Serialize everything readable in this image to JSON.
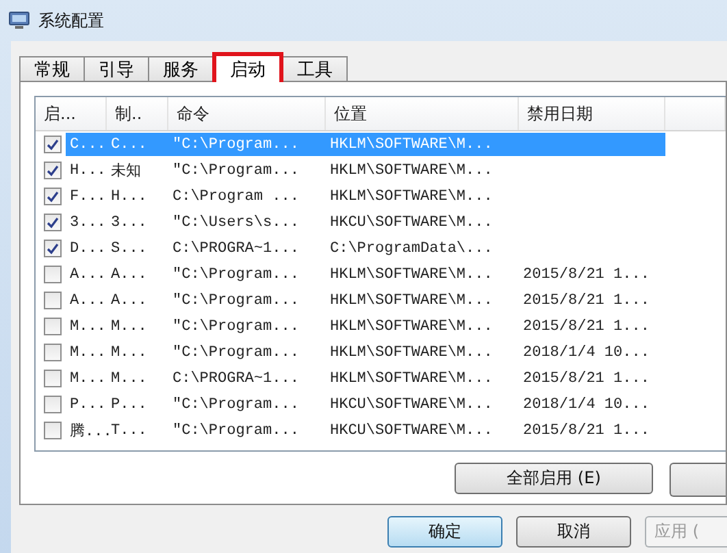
{
  "window": {
    "title": "系统配置"
  },
  "tabs": [
    {
      "label": "常规",
      "selected": false,
      "highlighted": false
    },
    {
      "label": "引导",
      "selected": false,
      "highlighted": false
    },
    {
      "label": "服务",
      "selected": false,
      "highlighted": false
    },
    {
      "label": "启动",
      "selected": true,
      "highlighted": true
    },
    {
      "label": "工具",
      "selected": false,
      "highlighted": false
    }
  ],
  "table": {
    "columns": [
      "启...",
      "制..",
      "命令",
      "位置",
      "禁用日期"
    ],
    "rows": [
      {
        "checked": true,
        "selected": true,
        "cells": [
          "C...",
          "C...",
          "\"C:\\Program...",
          "HKLM\\SOFTWARE\\M..."
        ]
      },
      {
        "checked": true,
        "selected": false,
        "cells": [
          "H...",
          "未知",
          "\"C:\\Program...",
          "HKLM\\SOFTWARE\\M..."
        ]
      },
      {
        "checked": true,
        "selected": false,
        "cells": [
          "F...",
          "H...",
          "C:\\Program ...",
          "HKLM\\SOFTWARE\\M..."
        ]
      },
      {
        "checked": true,
        "selected": false,
        "cells": [
          "3...",
          "3...",
          "\"C:\\Users\\s...",
          "HKCU\\SOFTWARE\\M..."
        ]
      },
      {
        "checked": true,
        "selected": false,
        "cells": [
          "D...",
          "S...",
          "C:\\PROGRA~1...",
          "C:\\ProgramData\\..."
        ]
      },
      {
        "checked": false,
        "selected": false,
        "cells": [
          "A...",
          "A...",
          "\"C:\\Program...",
          "HKLM\\SOFTWARE\\M...",
          "2015/8/21 1..."
        ]
      },
      {
        "checked": false,
        "selected": false,
        "cells": [
          "A...",
          "A...",
          "\"C:\\Program...",
          "HKLM\\SOFTWARE\\M...",
          "2015/8/21 1..."
        ]
      },
      {
        "checked": false,
        "selected": false,
        "cells": [
          "M...",
          "M...",
          "\"C:\\Program...",
          "HKLM\\SOFTWARE\\M...",
          "2015/8/21 1..."
        ]
      },
      {
        "checked": false,
        "selected": false,
        "cells": [
          "M...",
          "M...",
          "\"C:\\Program...",
          "HKLM\\SOFTWARE\\M...",
          "2018/1/4 10..."
        ]
      },
      {
        "checked": false,
        "selected": false,
        "cells": [
          "M...",
          "M...",
          "C:\\PROGRA~1...",
          "HKLM\\SOFTWARE\\M...",
          "2015/8/21 1..."
        ]
      },
      {
        "checked": false,
        "selected": false,
        "cells": [
          "P...",
          "P...",
          "\"C:\\Program...",
          "HKCU\\SOFTWARE\\M...",
          "2018/1/4 10..."
        ]
      },
      {
        "checked": false,
        "selected": false,
        "cells": [
          "腾...",
          "T...",
          "\"C:\\Program...",
          "HKCU\\SOFTWARE\\M...",
          "2015/8/21 1..."
        ]
      }
    ]
  },
  "list_buttons": [
    "全部启用 (E)"
  ],
  "dialog_buttons": [
    {
      "label": "确定",
      "default": true,
      "disabled": false
    },
    {
      "label": "取消",
      "default": false,
      "disabled": false
    },
    {
      "label": "应用 (",
      "default": false,
      "disabled": true
    }
  ]
}
